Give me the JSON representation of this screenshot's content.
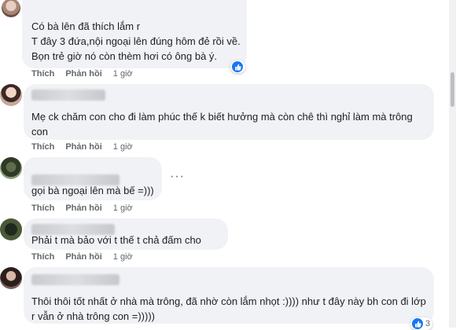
{
  "actions": {
    "like": "Thích",
    "reply": "Phản hồi"
  },
  "comments": [
    {
      "lines": [
        "Có bà lên đã thích lắm r",
        "T đây 3 đứa,nội ngoại lên đúng hôm đẻ rồi về.",
        "Bọn trẻ giờ nó còn thèm hơi có ông bà ý."
      ],
      "time": "1 giờ",
      "reaction_icon": "like-icon",
      "reaction_count": ""
    },
    {
      "lines": [
        "Mẹ ck chăm con cho đi làm phúc thế k biết hưởng mà còn chê thì nghỉ làm mà trông",
        "con"
      ],
      "time": "1 giờ"
    },
    {
      "lines": [
        "gọi bà ngoại lên mà bế =)))"
      ],
      "time": "1 giờ",
      "more": "···"
    },
    {
      "lines": [
        "Phải t mà bảo với t thế t chả đấm cho"
      ],
      "time": "1 giờ"
    },
    {
      "lines": [
        "Thôi thôi tốt nhất ở nhà mà trông, đã nhờ còn lắm nhọt :)))) như t đây này bh con đi lớp",
        "r vẫn ở nhà trông con =)))))"
      ],
      "reaction_icon": "like-icon",
      "reaction_count": "3"
    }
  ]
}
